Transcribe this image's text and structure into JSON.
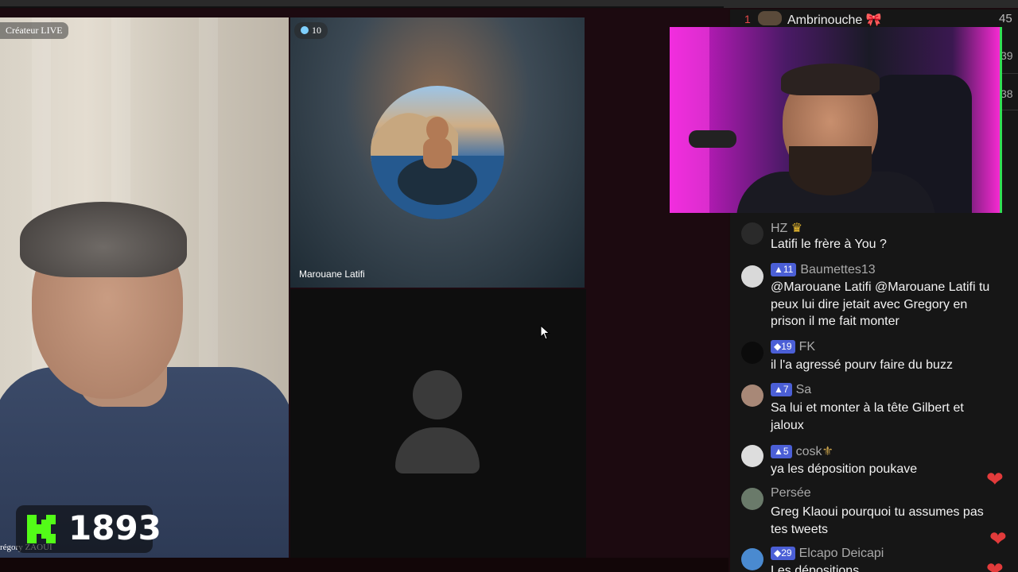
{
  "left_tile": {
    "creator_label": "Créateur LIVE",
    "name": "régory ZAOUI"
  },
  "kick_counter": {
    "logo": "kick-logo-icon",
    "value": "1893",
    "color": "#53fc18"
  },
  "right_tile": {
    "viewer_count": "10",
    "name": "Marouane Latifi"
  },
  "leaderboard": {
    "rank": "1",
    "name": "Ambrinouche",
    "icon": "ribbon-icon",
    "score": "45",
    "side_numbers": [
      "39",
      "38"
    ]
  },
  "chat": {
    "messages": [
      {
        "user": "HZ",
        "user_icon": "crown-icon",
        "badge": "",
        "text": "Latifi le frère à You ?",
        "avatar_color": "#3a3a3a"
      },
      {
        "user": "Baumettes13",
        "badge": "11",
        "badge_icon": "triangle-icon",
        "text": "@Marouane Latifi @Marouane Latifi tu peux lui dire jetait avec Gregory en prison il me fait monter",
        "avatar_color": "#d9d9d9"
      },
      {
        "user": "FK",
        "badge": "19",
        "badge_icon": "diamond-icon",
        "text": "il l'a agressé pourv faire du buzz",
        "avatar_color": "#111111"
      },
      {
        "user": "Sa",
        "badge": "7",
        "badge_icon": "triangle-icon",
        "text": "Sa lui et monter à la tête Gilbert et jaloux",
        "avatar_color": "#a88877"
      },
      {
        "user": "cosk",
        "user_icon": "fleur-de-lis-icon",
        "badge": "5",
        "badge_icon": "triangle-icon",
        "text": "ya les déposition poukave",
        "avatar_color": "#dddddd"
      },
      {
        "user": "Persée",
        "badge": "",
        "text": "Greg Klaoui pourquoi tu assumes pas tes tweets",
        "avatar_color": "#6a7a6a"
      },
      {
        "user": "Elcapo Deicapi",
        "badge": "29",
        "badge_icon": "diamond-icon",
        "text": "Les dépositions",
        "avatar_color": "#4a8ad0"
      }
    ]
  },
  "colors": {
    "chat_bg": "#161616",
    "badge_bg": "#4b5fd6",
    "heart": "#e23b3b"
  }
}
